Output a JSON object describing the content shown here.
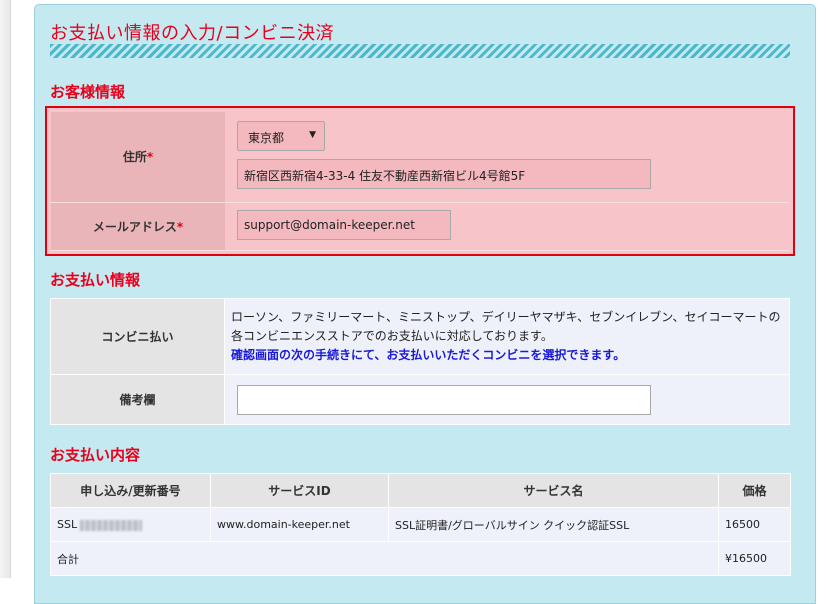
{
  "page": {
    "title": "お支払い情報の入力/コンビニ決済"
  },
  "customer": {
    "heading": "お客様情報",
    "address_label": "住所",
    "email_label": "メールアドレス",
    "required_mark": "*",
    "prefecture": "東京都",
    "address_value": "新宿区西新宿4-33-4 住友不動産西新宿ビル4号館5F",
    "email_value": "support@domain-keeper.net"
  },
  "payment": {
    "heading": "お支払い情報",
    "method_label": "コンビニ払い",
    "method_description": "ローソン、ファミリーマート、ミニストップ、デイリーヤマザキ、セブンイレブン、セイコーマートの各コンビニエンスストアでのお支払いに対応しております。",
    "method_note": "確認画面の次の手続きにて、お支払いいただくコンビニを選択できます。",
    "remarks_label": "備考欄",
    "remarks_value": ""
  },
  "order": {
    "heading": "お支払い内容",
    "columns": [
      "申し込み/更新番号",
      "サービスID",
      "サービス名",
      "価格"
    ],
    "rows": [
      {
        "number_prefix": "SSL",
        "service_id": "www.domain-keeper.net",
        "service_name": "SSL証明書/グローバルサイン クイック認証SSL",
        "price": "16500"
      }
    ],
    "total_label": "合計",
    "total_value": "¥16500"
  },
  "colors": {
    "accent_red": "#e8001c",
    "panel_bg": "#c4e9f0",
    "note_blue": "#1a1ad6"
  }
}
